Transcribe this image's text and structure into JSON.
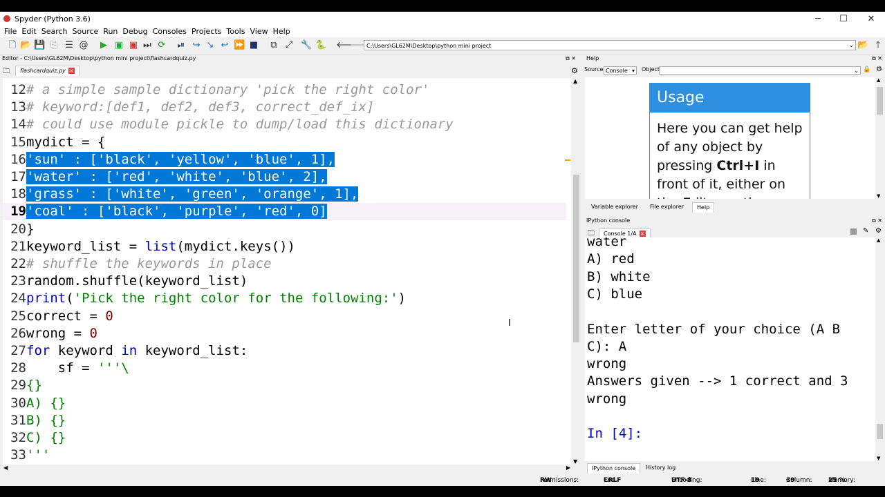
{
  "window": {
    "title": "Spyder (Python 3.6)",
    "minimize": "─",
    "maximize": "☐",
    "close": "✕"
  },
  "menu": [
    "File",
    "Edit",
    "Search",
    "Source",
    "Run",
    "Debug",
    "Consoles",
    "Projects",
    "Tools",
    "View",
    "Help"
  ],
  "toolbar": {
    "path": "C:\\Users\\GL62M\\Desktop\\python mini project"
  },
  "editor": {
    "header": "Editor - C:\\Users\\GL62M\\Desktop\\python mini project\\flashcardquiz.py",
    "tab": "flashcardquiz.py",
    "lines": [
      {
        "n": "12",
        "html": "cm",
        "text": "# a simple sample dictionary 'pick the right color'"
      },
      {
        "n": "13",
        "html": "cm",
        "text": "# keyword:[def1, def2, def3, correct_def_ix]"
      },
      {
        "n": "14",
        "html": "cm",
        "text": "# could use module pickle to dump/load this dictionary"
      },
      {
        "n": "15",
        "text": "mydict = {"
      },
      {
        "n": "16",
        "sel": "'sun' : ['black', 'yellow', 'blue', 1],"
      },
      {
        "n": "17",
        "sel": "'water' : ['red', 'white', 'blue', 2],"
      },
      {
        "n": "18",
        "sel": "'grass' : ['white', 'green', 'orange', 1],"
      },
      {
        "n": "19",
        "sel": "'coal' : ['black', 'purple', 'red', 0]"
      },
      {
        "n": "20",
        "text": "}"
      },
      {
        "n": "21",
        "a": "keyword_list = ",
        "b": "list",
        "c": "(mydict.keys())"
      },
      {
        "n": "22",
        "html": "cm",
        "text": "# shuffle the keywords in place"
      },
      {
        "n": "23",
        "text": "random.shuffle(keyword_list)"
      },
      {
        "n": "24",
        "a": "",
        "b": "print",
        "c": "(",
        "d": "'Pick the right color for the following:'",
        "e": ")"
      },
      {
        "n": "25",
        "a": "correct = ",
        "num": "0"
      },
      {
        "n": "26",
        "a": "wrong = ",
        "num": "0"
      },
      {
        "n": "27",
        "k1": "for",
        "m": " keyword ",
        "k2": "in",
        "t": " keyword_list:"
      },
      {
        "n": "28",
        "a": "    sf = ",
        "d": "'''\\"
      },
      {
        "n": "29",
        "d": "{}"
      },
      {
        "n": "30",
        "d": "A) {}"
      },
      {
        "n": "31",
        "d": "B) {}"
      },
      {
        "n": "32",
        "d": "C) {}"
      },
      {
        "n": "33",
        "d": "'''"
      }
    ]
  },
  "help": {
    "header": "Help",
    "source_label": "Source",
    "source_value": "Console",
    "object_label": "Object",
    "usage_title": "Usage",
    "usage_text_1": "Here you can get help of any object by pressing ",
    "usage_bold": "Ctrl+I",
    "usage_text_2": " in front of it, either on the Editor or the",
    "tabs": [
      "Variable explorer",
      "File explorer",
      "Help"
    ]
  },
  "console": {
    "header": "IPython console",
    "tab": "Console 1/A",
    "lines": [
      "water",
      "A) red",
      "B) white",
      "C) blue",
      "",
      "Enter letter of your choice (A B",
      "C): A",
      "wrong",
      "Answers given --> 1 correct and 3",
      "wrong",
      ""
    ],
    "prompt": "In [4]:",
    "bottom_tabs": [
      "IPython console",
      "History log"
    ]
  },
  "status": {
    "permissions_label": "Permissions:",
    "permissions": "RW",
    "eol_label": "End-of-lines:",
    "eol": "CRLF",
    "encoding_label": "Encoding:",
    "encoding": "UTF-8",
    "line_label": "Line:",
    "line": "19",
    "column_label": "Column:",
    "column": "39",
    "memory_label": "Memory:",
    "memory": "25 %"
  }
}
